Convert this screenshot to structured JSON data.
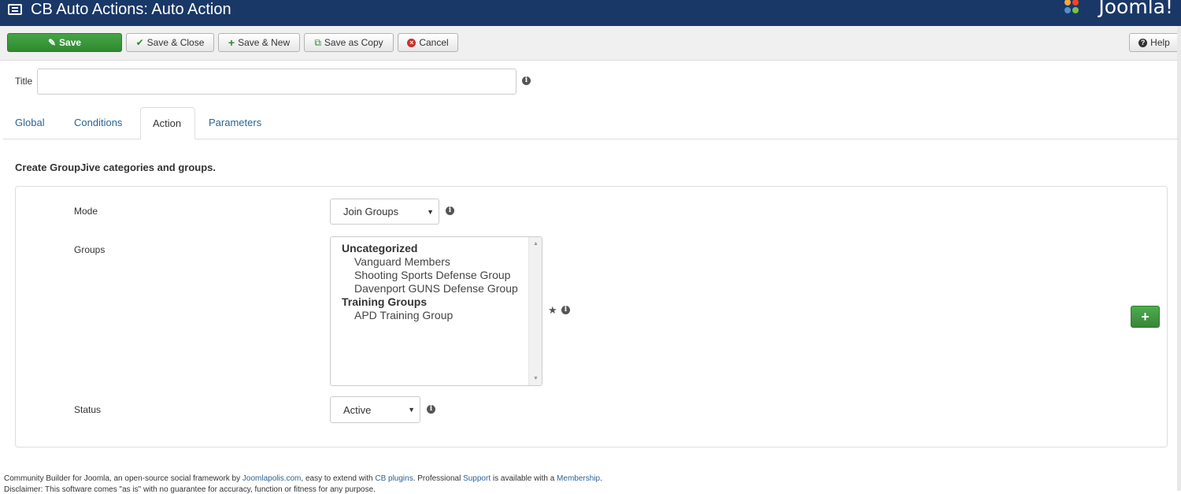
{
  "header": {
    "title": "CB Auto Actions: Auto Action",
    "logo_text": "Joomla!"
  },
  "toolbar": {
    "save": "Save",
    "save_close": "Save & Close",
    "save_new": "Save & New",
    "save_copy": "Save as Copy",
    "cancel": "Cancel",
    "help": "Help"
  },
  "form": {
    "title_label": "Title",
    "title_value": ""
  },
  "tabs": [
    "Global",
    "Conditions",
    "Action",
    "Parameters"
  ],
  "active_tab": "Action",
  "section_heading": "Create GroupJive categories and groups.",
  "fields": {
    "mode_label": "Mode",
    "mode_value": "Join Groups",
    "groups_label": "Groups",
    "status_label": "Status",
    "status_value": "Active"
  },
  "groups": [
    {
      "category": "Uncategorized",
      "items": [
        "Vanguard Members",
        "Shooting Sports Defense Group",
        "Davenport GUNS Defense Group"
      ]
    },
    {
      "category": "Training Groups",
      "items": [
        "APD Training Group"
      ]
    }
  ],
  "footer": {
    "line1_a": "Community Builder for Joomla, an open-source social framework by ",
    "link_joomlapolis": "Joomlapolis.com",
    "line1_b": ", easy to extend with ",
    "link_plugins": "CB plugins",
    "line1_c": ". Professional ",
    "link_support": "Support",
    "line1_d": " is available with a ",
    "link_membership": "Membership",
    "line1_e": ".",
    "line2": "Disclaimer: This software comes \"as is\" with no guarantee for accuracy, function or fitness for any purpose."
  },
  "colors": {
    "header_bg": "#1a3867",
    "save_green": "#3c9b3c",
    "link": "#2a6496"
  }
}
